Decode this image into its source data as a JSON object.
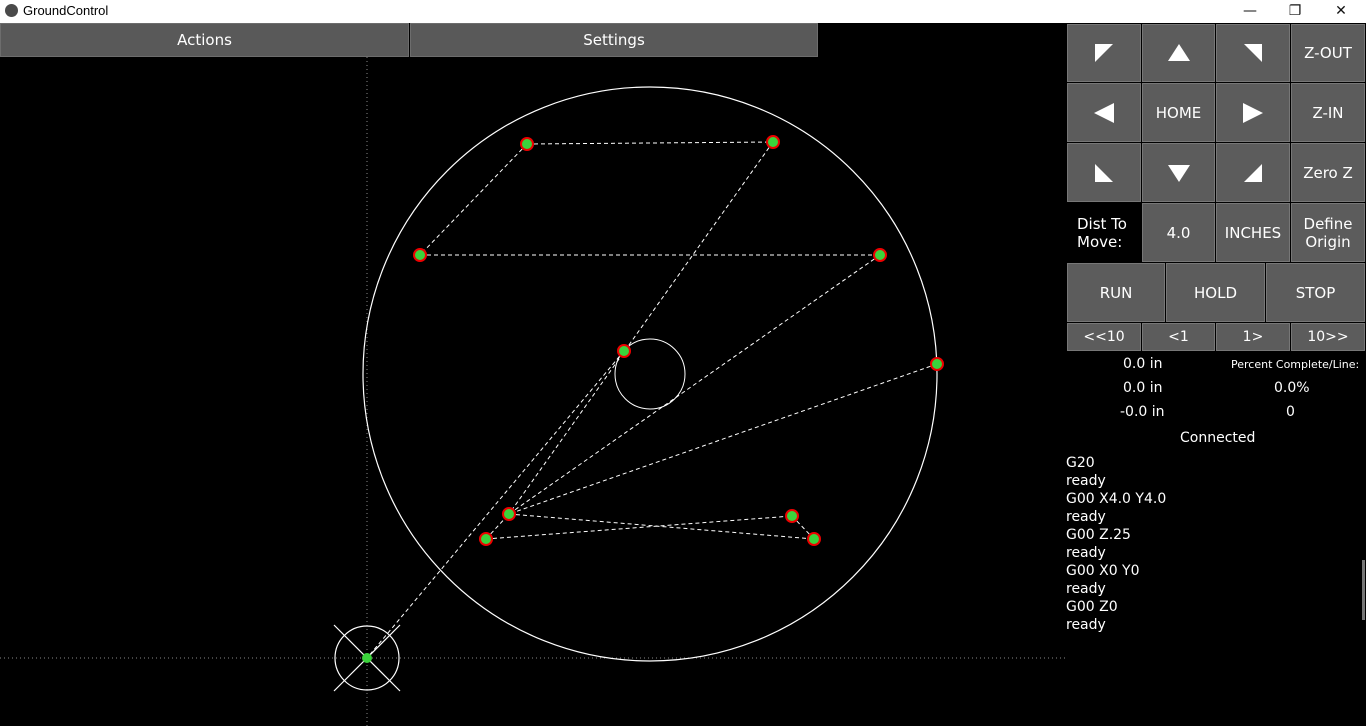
{
  "window": {
    "title": "GroundControl",
    "minimize": "—",
    "maximize": "❐",
    "close": "✕"
  },
  "menu": {
    "actions": "Actions",
    "settings": "Settings"
  },
  "jog": {
    "z_out": "Z-OUT",
    "home": "HOME",
    "z_in": "Z-IN",
    "zero_z": "Zero Z",
    "dist_label": "Dist To Move:",
    "dist_value": "4.0",
    "units": "INCHES",
    "define_origin": "Define Origin"
  },
  "run": {
    "run": "RUN",
    "hold": "HOLD",
    "stop": "STOP"
  },
  "step": {
    "back10": "<<10",
    "back1": "<1",
    "fwd1": "1>",
    "fwd10": "10>>"
  },
  "position": {
    "x": "0.0 in",
    "y": "0.0 in",
    "z": "-0.0 in"
  },
  "progress": {
    "label": "Percent Complete/Line:",
    "percent": "0.0%",
    "line": "0"
  },
  "status": "Connected",
  "console": [
    "G20",
    "ready",
    "G00 X4.0 Y4.0",
    "ready",
    "G00 Z.25",
    "ready",
    "G00 X0 Y0",
    "ready",
    "G00 Z0",
    "ready"
  ]
}
